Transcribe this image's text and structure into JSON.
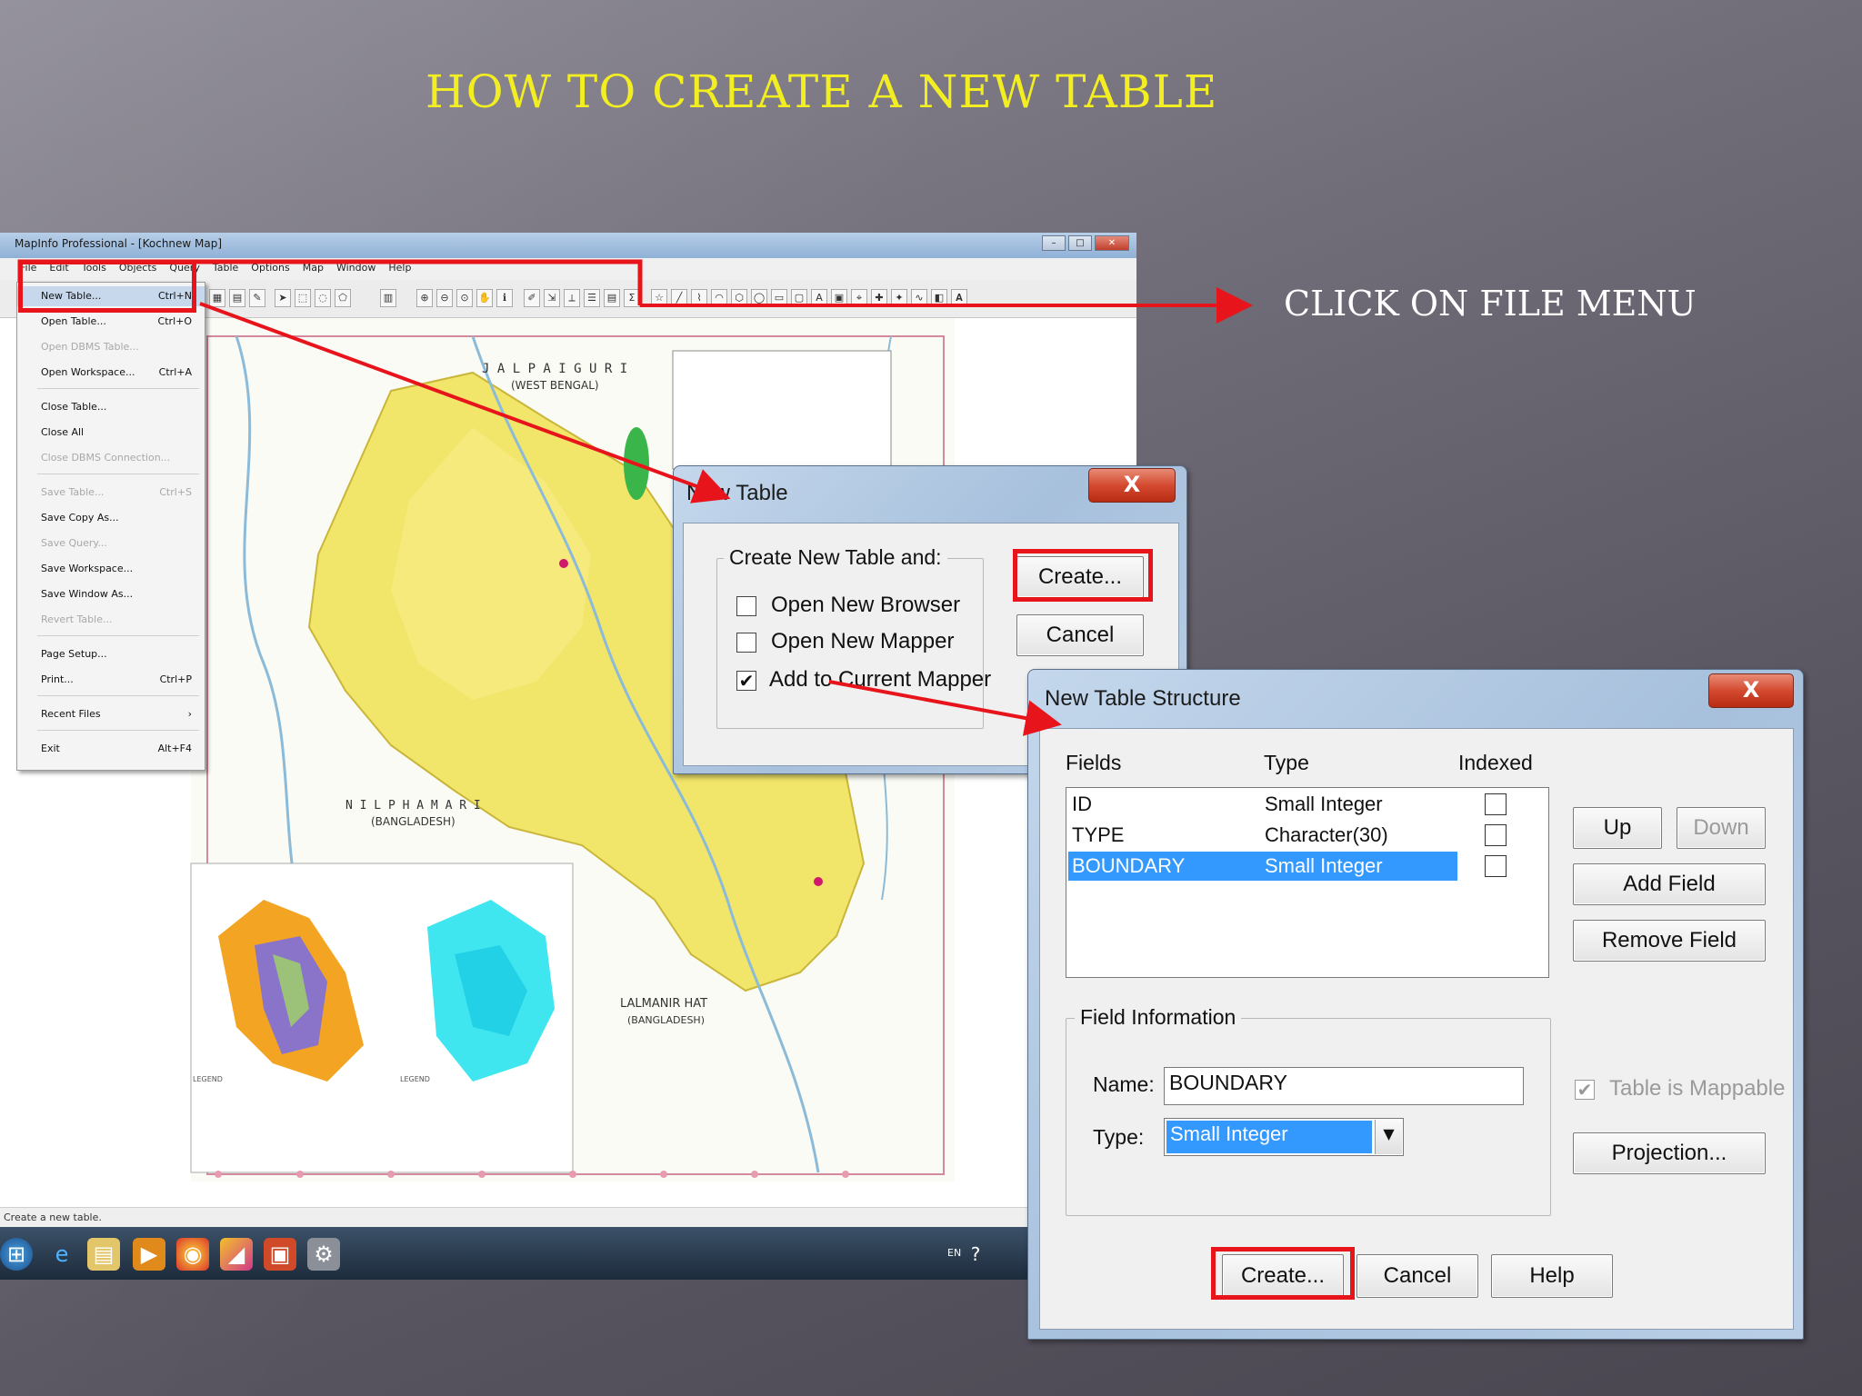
{
  "slide": {
    "title": "HOW TO CREATE A NEW TABLE",
    "callout": "CLICK ON FILE MENU"
  },
  "colors": {
    "title": "#f2ee22",
    "highlight": "#e8141c",
    "selection": "#3399ff"
  },
  "mapinfo": {
    "window_title": "MapInfo Professional - [Kochnew Map]",
    "menu": [
      "File",
      "Edit",
      "Tools",
      "Objects",
      "Query",
      "Table",
      "Options",
      "Map",
      "Window",
      "Help"
    ],
    "status_text": "Create a new table.",
    "tray_lang": "EN",
    "file_menu": [
      {
        "label": "New Table...",
        "shortcut": "Ctrl+N",
        "state": "highlight"
      },
      {
        "label": "Open Table...",
        "shortcut": "Ctrl+O",
        "state": "normal"
      },
      {
        "label": "Open DBMS Table...",
        "shortcut": "",
        "state": "disabled"
      },
      {
        "label": "Open Workspace...",
        "shortcut": "Ctrl+A",
        "state": "normal"
      },
      {
        "label": "Close Table...",
        "shortcut": "",
        "state": "normal"
      },
      {
        "label": "Close All",
        "shortcut": "",
        "state": "normal"
      },
      {
        "label": "Close DBMS Connection...",
        "shortcut": "",
        "state": "disabled"
      },
      {
        "label": "Save Table...",
        "shortcut": "Ctrl+S",
        "state": "disabled"
      },
      {
        "label": "Save Copy As...",
        "shortcut": "",
        "state": "normal"
      },
      {
        "label": "Save Query...",
        "shortcut": "",
        "state": "disabled"
      },
      {
        "label": "Save Workspace...",
        "shortcut": "",
        "state": "normal"
      },
      {
        "label": "Save Window As...",
        "shortcut": "",
        "state": "normal"
      },
      {
        "label": "Revert Table...",
        "shortcut": "",
        "state": "disabled"
      },
      {
        "label": "Page Setup...",
        "shortcut": "",
        "state": "normal"
      },
      {
        "label": "Print...",
        "shortcut": "Ctrl+P",
        "state": "normal"
      },
      {
        "label": "Recent Files",
        "shortcut": "›",
        "state": "normal"
      },
      {
        "label": "Exit",
        "shortcut": "Alt+F4",
        "state": "normal"
      }
    ],
    "map_labels": {
      "jalpaiguri": "J A L P A I G U R I",
      "west_bengal": "(WEST BENGAL)",
      "nilphamari": "N I L P H A M A R I",
      "bangladesh1": "(BANGLADESH)",
      "lalmanirhat": "LALMANIR HAT",
      "bangladesh2": "(BANGLADESH)",
      "legend1": "LEGEND",
      "legend2": "LEGEND"
    }
  },
  "new_table": {
    "title": "New Table",
    "close": "X",
    "group_label": "Create New Table and:",
    "options": [
      {
        "label": "Open New Browser",
        "checked": false
      },
      {
        "label": "Open New Mapper",
        "checked": false
      },
      {
        "label": "Add to Current Mapper",
        "checked": true
      }
    ],
    "check_mark": "✔",
    "create_label": "Create...",
    "cancel_label": "Cancel"
  },
  "structure": {
    "title": "New Table Structure",
    "close": "X",
    "col_fields": "Fields",
    "col_type": "Type",
    "col_indexed": "Indexed",
    "rows": [
      {
        "field": "ID",
        "type": "Small Integer",
        "indexed": false,
        "selected": false
      },
      {
        "field": "TYPE",
        "type": "Character(30)",
        "indexed": false,
        "selected": false
      },
      {
        "field": "BOUNDARY",
        "type": "Small Integer",
        "indexed": false,
        "selected": true
      }
    ],
    "up_label": "Up",
    "down_label": "Down",
    "add_field_label": "Add Field",
    "remove_field_label": "Remove Field",
    "field_info_label": "Field Information",
    "name_label": "Name:",
    "name_value": "BOUNDARY",
    "type_label": "Type:",
    "type_value": "Small Integer",
    "mappable_label": "Table is Mappable",
    "mappable_check": "✔",
    "projection_label": "Projection...",
    "create_label": "Create...",
    "cancel_label": "Cancel",
    "help_label": "Help"
  }
}
